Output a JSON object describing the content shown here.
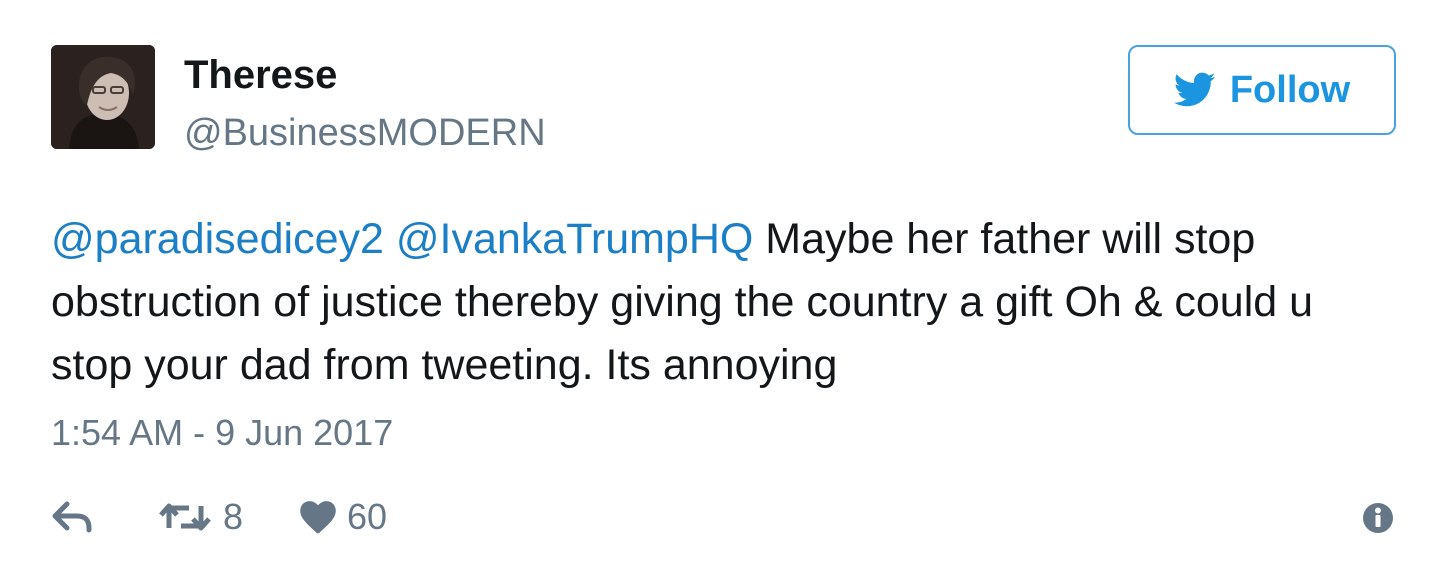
{
  "user": {
    "display_name": "Therese",
    "handle": "@BusinessMODERN",
    "avatar_icon": "profile-photo"
  },
  "follow_button": {
    "label": "Follow",
    "icon": "twitter-bird-icon",
    "color": "#1b95e0"
  },
  "tweet": {
    "mentions": [
      "@paradisedicey2",
      "@IvankaTrumpHQ"
    ],
    "text": "Maybe her father will stop obstruction of justice thereby giving the country a gift Oh & could u stop your dad from tweeting. Its annoying",
    "timestamp": "1:54 AM - 9 Jun 2017"
  },
  "actions": {
    "reply_icon": "reply-icon",
    "retweet_icon": "retweet-icon",
    "retweet_count": "8",
    "like_icon": "heart-icon",
    "like_count": "60",
    "info_icon": "info-icon"
  },
  "colors": {
    "link": "#1b7fc7",
    "muted": "#657786",
    "text": "#14171a",
    "button_border": "#4aa3df"
  }
}
